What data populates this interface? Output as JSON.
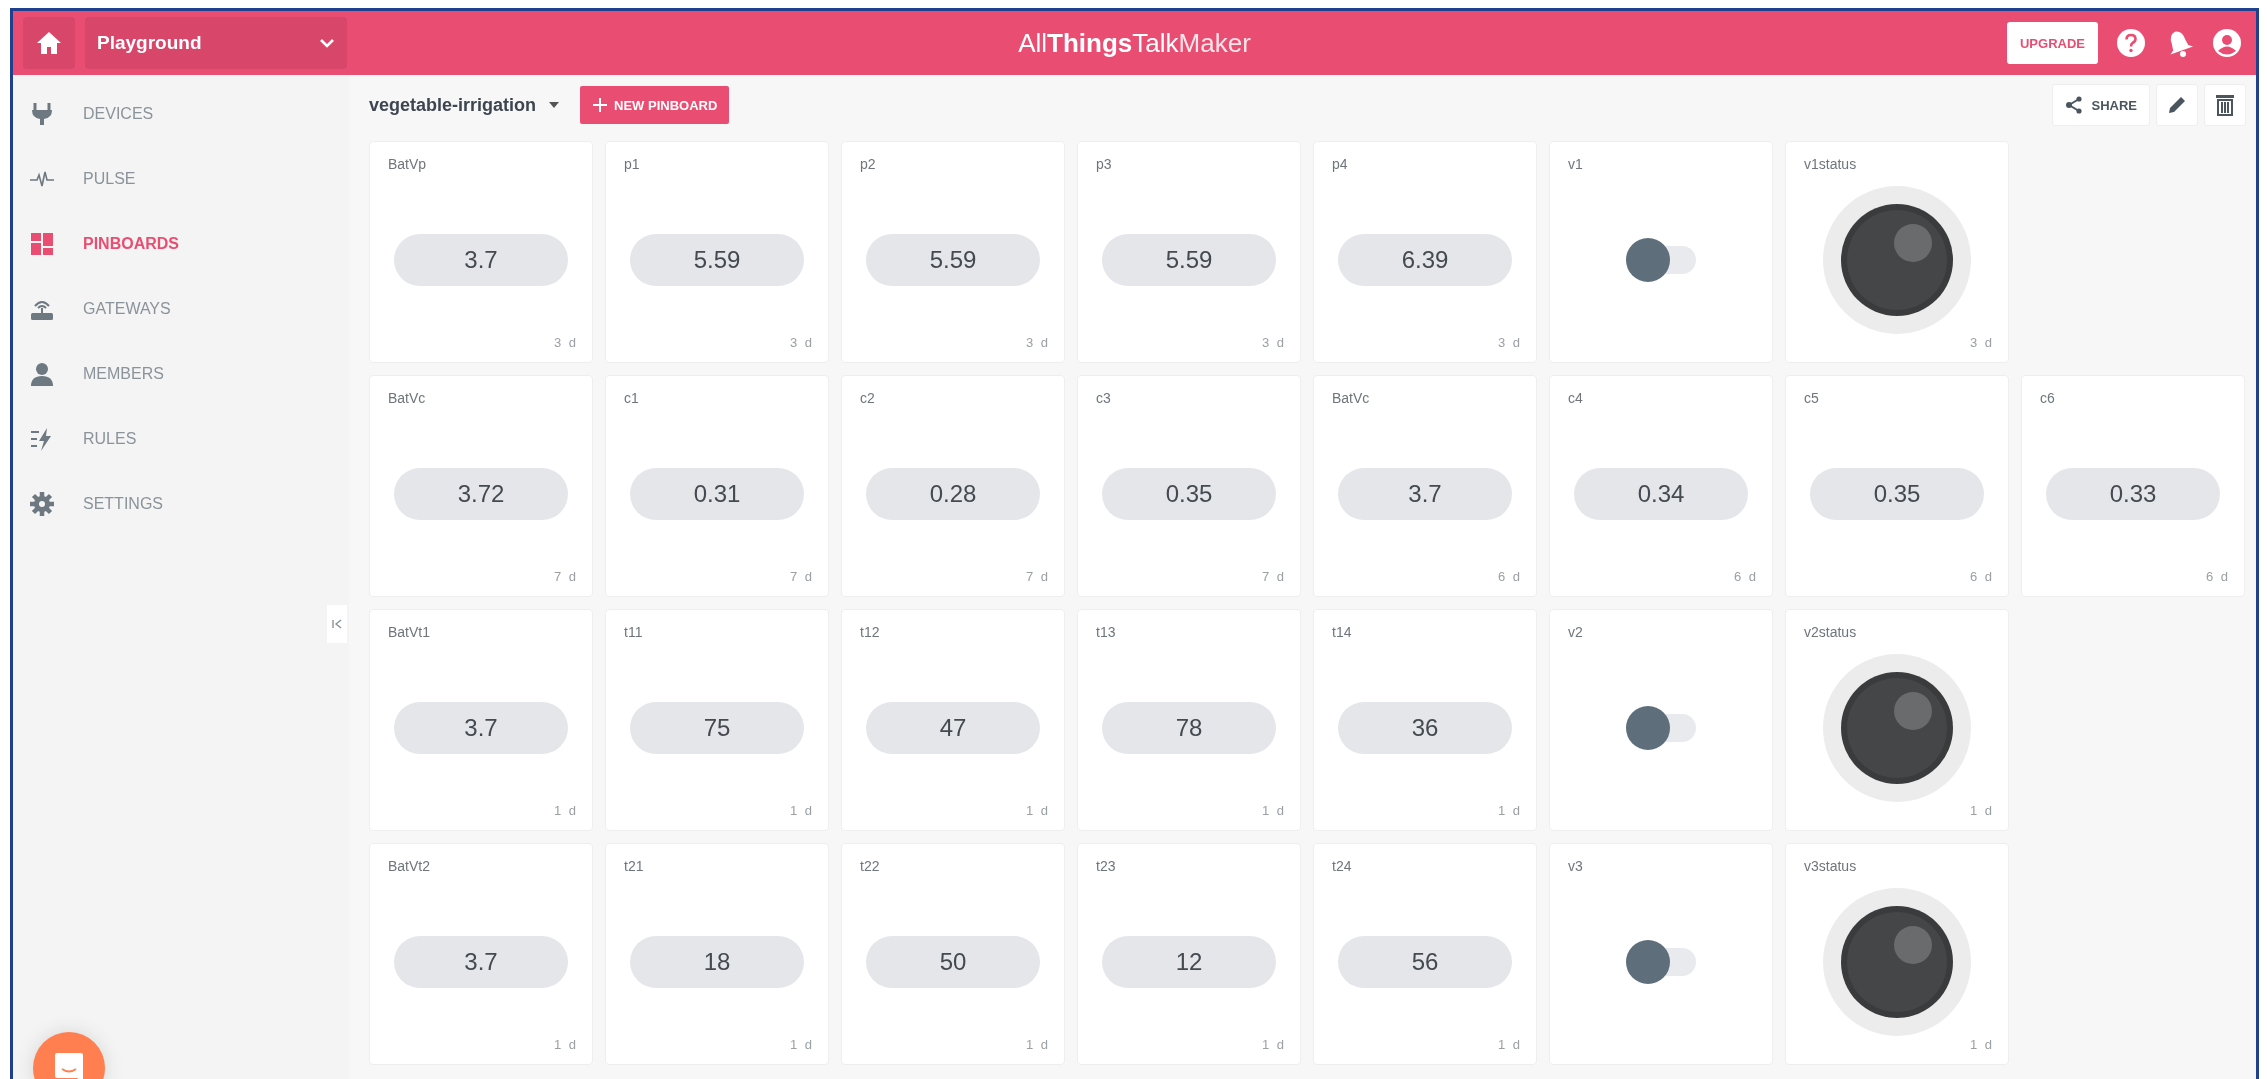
{
  "header": {
    "workspace": "Playground",
    "brand": "All**Things**Talk",
    "product": "Maker",
    "upgrade": "UPGRADE"
  },
  "sidebar": {
    "items": [
      {
        "label": "DEVICES",
        "selected": false
      },
      {
        "label": "PULSE",
        "selected": false
      },
      {
        "label": "PINBOARDS",
        "selected": true
      },
      {
        "label": "GATEWAYS",
        "selected": false
      },
      {
        "label": "MEMBERS",
        "selected": false
      },
      {
        "label": "RULES",
        "selected": false
      },
      {
        "label": "SETTINGS",
        "selected": false
      }
    ]
  },
  "pinboard": {
    "name": "vegetable-irrigation",
    "new_button": "NEW PINBOARD",
    "share": "SHARE"
  },
  "rows": [
    {
      "cards": [
        {
          "kind": "value",
          "title": "BatVp",
          "value": "3.7",
          "age": "3 d"
        },
        {
          "kind": "value",
          "title": "p1",
          "value": "5.59",
          "age": "3 d"
        },
        {
          "kind": "value",
          "title": "p2",
          "value": "5.59",
          "age": "3 d"
        },
        {
          "kind": "value",
          "title": "p3",
          "value": "5.59",
          "age": "3 d"
        },
        {
          "kind": "value",
          "title": "p4",
          "value": "6.39",
          "age": "3 d"
        },
        {
          "kind": "toggle",
          "title": "v1",
          "on": false
        },
        {
          "kind": "knob",
          "title": "v1status",
          "age": "3 d"
        }
      ]
    },
    {
      "cards": [
        {
          "kind": "value",
          "title": "BatVc",
          "value": "3.72",
          "age": "7 d"
        },
        {
          "kind": "value",
          "title": "c1",
          "value": "0.31",
          "age": "7 d"
        },
        {
          "kind": "value",
          "title": "c2",
          "value": "0.28",
          "age": "7 d"
        },
        {
          "kind": "value",
          "title": "c3",
          "value": "0.35",
          "age": "7 d"
        },
        {
          "kind": "value",
          "title": "BatVc",
          "value": "3.7",
          "age": "6 d"
        },
        {
          "kind": "value",
          "title": "c4",
          "value": "0.34",
          "age": "6 d"
        },
        {
          "kind": "value",
          "title": "c5",
          "value": "0.35",
          "age": "6 d"
        },
        {
          "kind": "value",
          "title": "c6",
          "value": "0.33",
          "age": "6 d"
        }
      ]
    },
    {
      "cards": [
        {
          "kind": "value",
          "title": "BatVt1",
          "value": "3.7",
          "age": "1 d"
        },
        {
          "kind": "value",
          "title": "t11",
          "value": "75",
          "age": "1 d"
        },
        {
          "kind": "value",
          "title": "t12",
          "value": "47",
          "age": "1 d"
        },
        {
          "kind": "value",
          "title": "t13",
          "value": "78",
          "age": "1 d"
        },
        {
          "kind": "value",
          "title": "t14",
          "value": "36",
          "age": "1 d"
        },
        {
          "kind": "toggle",
          "title": "v2",
          "on": false
        },
        {
          "kind": "knob",
          "title": "v2status",
          "age": "1 d"
        }
      ]
    },
    {
      "cards": [
        {
          "kind": "value",
          "title": "BatVt2",
          "value": "3.7",
          "age": "1 d"
        },
        {
          "kind": "value",
          "title": "t21",
          "value": "18",
          "age": "1 d"
        },
        {
          "kind": "value",
          "title": "t22",
          "value": "50",
          "age": "1 d"
        },
        {
          "kind": "value",
          "title": "t23",
          "value": "12",
          "age": "1 d"
        },
        {
          "kind": "value",
          "title": "t24",
          "value": "56",
          "age": "1 d"
        },
        {
          "kind": "toggle",
          "title": "v3",
          "on": false
        },
        {
          "kind": "knob",
          "title": "v3status",
          "age": "1 d"
        }
      ]
    }
  ]
}
